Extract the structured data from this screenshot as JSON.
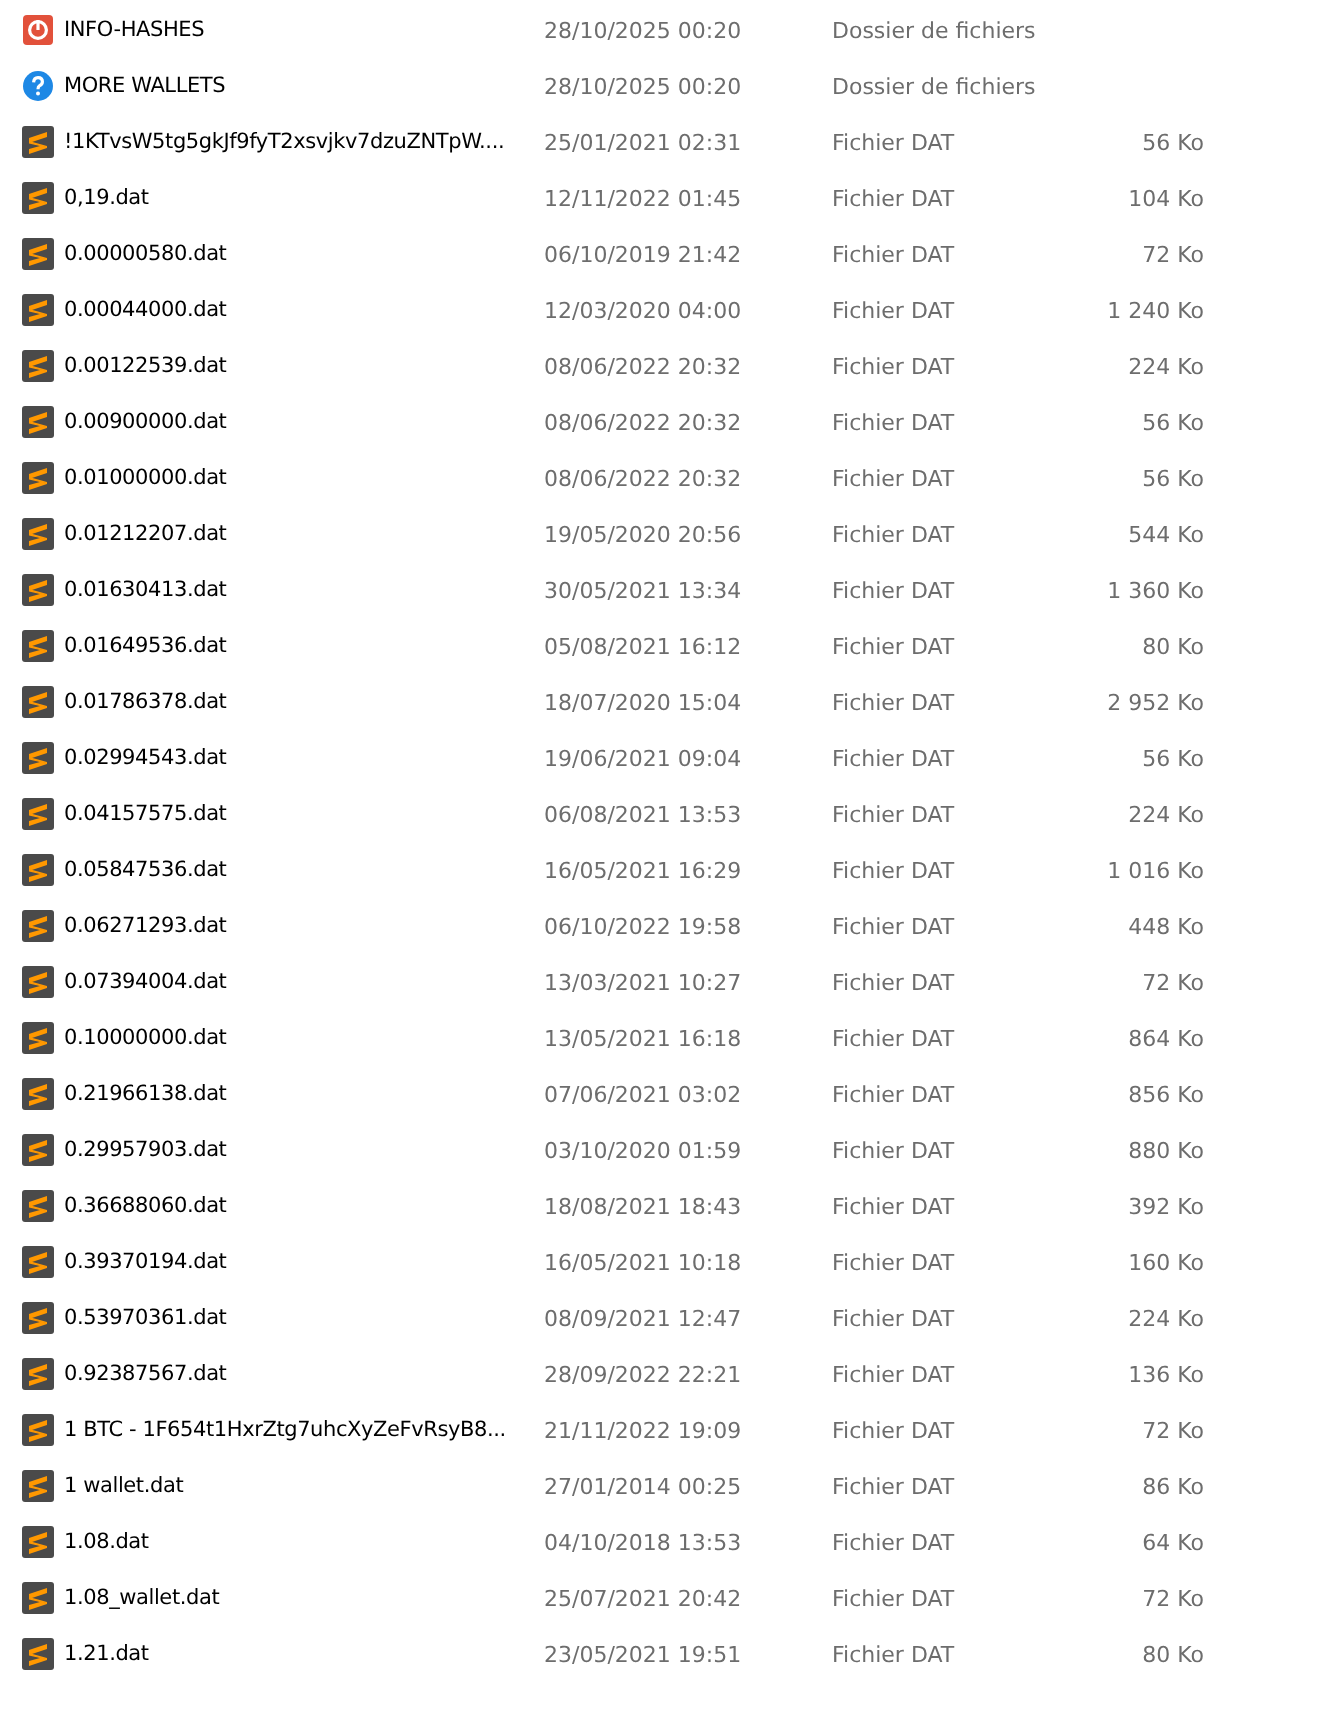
{
  "files": [
    {
      "kind": "power",
      "name": "INFO-HASHES",
      "modified": "28/10/2025 00:20",
      "type": "Dossier de fichiers"
    },
    {
      "kind": "help",
      "name": "MORE WALLETS",
      "modified": "28/10/2025 00:20",
      "type": "Dossier de fichiers"
    },
    {
      "kind": "dat",
      "name": "!1KTvsW5tg5gkJf9fyT2xsvjkv7dzuZNTpW....",
      "modified": "25/01/2021 02:31",
      "type": "Fichier DAT",
      "size": "56 Ko"
    },
    {
      "kind": "dat",
      "name": "0,19.dat",
      "modified": "12/11/2022 01:45",
      "type": "Fichier DAT",
      "size": "104 Ko"
    },
    {
      "kind": "dat",
      "name": "0.00000580.dat",
      "modified": "06/10/2019 21:42",
      "type": "Fichier DAT",
      "size": "72 Ko"
    },
    {
      "kind": "dat",
      "name": "0.00044000.dat",
      "modified": "12/03/2020 04:00",
      "type": "Fichier DAT",
      "size": "1 240 Ko"
    },
    {
      "kind": "dat",
      "name": "0.00122539.dat",
      "modified": "08/06/2022 20:32",
      "type": "Fichier DAT",
      "size": "224 Ko"
    },
    {
      "kind": "dat",
      "name": "0.00900000.dat",
      "modified": "08/06/2022 20:32",
      "type": "Fichier DAT",
      "size": "56 Ko"
    },
    {
      "kind": "dat",
      "name": "0.01000000.dat",
      "modified": "08/06/2022 20:32",
      "type": "Fichier DAT",
      "size": "56 Ko"
    },
    {
      "kind": "dat",
      "name": "0.01212207.dat",
      "modified": "19/05/2020 20:56",
      "type": "Fichier DAT",
      "size": "544 Ko"
    },
    {
      "kind": "dat",
      "name": "0.01630413.dat",
      "modified": "30/05/2021 13:34",
      "type": "Fichier DAT",
      "size": "1 360 Ko"
    },
    {
      "kind": "dat",
      "name": "0.01649536.dat",
      "modified": "05/08/2021 16:12",
      "type": "Fichier DAT",
      "size": "80 Ko"
    },
    {
      "kind": "dat",
      "name": "0.01786378.dat",
      "modified": "18/07/2020 15:04",
      "type": "Fichier DAT",
      "size": "2 952 Ko"
    },
    {
      "kind": "dat",
      "name": "0.02994543.dat",
      "modified": "19/06/2021 09:04",
      "type": "Fichier DAT",
      "size": "56 Ko"
    },
    {
      "kind": "dat",
      "name": "0.04157575.dat",
      "modified": "06/08/2021 13:53",
      "type": "Fichier DAT",
      "size": "224 Ko"
    },
    {
      "kind": "dat",
      "name": "0.05847536.dat",
      "modified": "16/05/2021 16:29",
      "type": "Fichier DAT",
      "size": "1 016 Ko"
    },
    {
      "kind": "dat",
      "name": "0.06271293.dat",
      "modified": "06/10/2022 19:58",
      "type": "Fichier DAT",
      "size": "448 Ko"
    },
    {
      "kind": "dat",
      "name": "0.07394004.dat",
      "modified": "13/03/2021 10:27",
      "type": "Fichier DAT",
      "size": "72 Ko"
    },
    {
      "kind": "dat",
      "name": "0.10000000.dat",
      "modified": "13/05/2021 16:18",
      "type": "Fichier DAT",
      "size": "864 Ko"
    },
    {
      "kind": "dat",
      "name": "0.21966138.dat",
      "modified": "07/06/2021 03:02",
      "type": "Fichier DAT",
      "size": "856 Ko"
    },
    {
      "kind": "dat",
      "name": "0.29957903.dat",
      "modified": "03/10/2020 01:59",
      "type": "Fichier DAT",
      "size": "880 Ko"
    },
    {
      "kind": "dat",
      "name": "0.36688060.dat",
      "modified": "18/08/2021 18:43",
      "type": "Fichier DAT",
      "size": "392 Ko"
    },
    {
      "kind": "dat",
      "name": "0.39370194.dat",
      "modified": "16/05/2021 10:18",
      "type": "Fichier DAT",
      "size": "160 Ko"
    },
    {
      "kind": "dat",
      "name": "0.53970361.dat",
      "modified": "08/09/2021 12:47",
      "type": "Fichier DAT",
      "size": "224 Ko"
    },
    {
      "kind": "dat",
      "name": "0.92387567.dat",
      "modified": "28/09/2022 22:21",
      "type": "Fichier DAT",
      "size": "136 Ko"
    },
    {
      "kind": "dat",
      "name": "1 BTC - 1F654t1HxrZtg7uhcXyZeFvRsyB8...",
      "modified": "21/11/2022 19:09",
      "type": "Fichier DAT",
      "size": "72 Ko"
    },
    {
      "kind": "dat",
      "name": "1 wallet.dat",
      "modified": "27/01/2014 00:25",
      "type": "Fichier DAT",
      "size": "86 Ko"
    },
    {
      "kind": "dat",
      "name": "1.08.dat",
      "modified": "04/10/2018 13:53",
      "type": "Fichier DAT",
      "size": "64 Ko"
    },
    {
      "kind": "dat",
      "name": "1.08_wallet.dat",
      "modified": "25/07/2021 20:42",
      "type": "Fichier DAT",
      "size": "72 Ko"
    },
    {
      "kind": "dat",
      "name": "1.21.dat",
      "modified": "23/05/2021 19:51",
      "type": "Fichier DAT",
      "size": "80 Ko"
    }
  ]
}
